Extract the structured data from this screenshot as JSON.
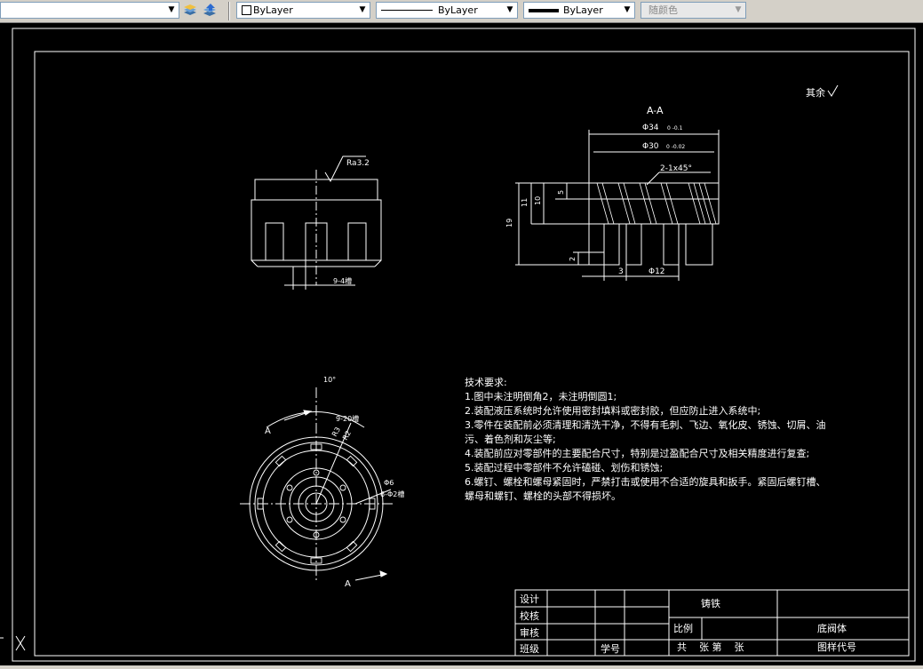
{
  "toolbar": {
    "layer_combo": {
      "value": ""
    },
    "color_combo": {
      "value": "ByLayer"
    },
    "linetype_combo": {
      "value": "ByLayer"
    },
    "lineweight_combo": {
      "value": "ByLayer"
    },
    "plotstyle_combo": {
      "value": "随颜色"
    }
  },
  "drawing": {
    "section_label": "A-A",
    "dim_phi34": "Φ34",
    "dim_phi34_tol": "0 -0.1",
    "dim_phi30": "Φ30",
    "dim_phi30_tol": "0 -0.02",
    "chamfer": "2-1x45°",
    "dim_19": "19",
    "dim_11": "11",
    "dim_10": "10",
    "dim_5": "5",
    "dim_2": "2",
    "dim_3": "3",
    "dim_phi12": "Φ12",
    "roughness": "Ra3.2",
    "dim_slot": "9-4槽",
    "other_roughness": "其余",
    "angle_10": "10°",
    "dim_9_20": "9-20槽",
    "dim_6_phi2": "6-Φ2槽",
    "dim_phi6": "Φ6",
    "dim_r3": "R3",
    "dim_r2": "R2",
    "cut_a_top": "A",
    "cut_a_bottom": "A"
  },
  "tech": {
    "title": "技术要求:",
    "lines": [
      "1.图中未注明倒角2，未注明倒圆1;",
      "2.装配液压系统时允许使用密封填料或密封胶，但应防止进入系统中;",
      "3.零件在装配前必须清理和清洗干净，不得有毛刺、飞边、氧化皮、锈蚀、切屑、油",
      "污、着色剂和灰尘等;",
      "4.装配前应对零部件的主要配合尺寸，特别是过盈配合尺寸及相关精度进行复查;",
      "5.装配过程中零部件不允许磕碰、划伤和锈蚀;",
      "6.螺钉、螺栓和螺母紧固时，严禁打击或使用不合适的旋具和扳手。紧固后螺钉槽、",
      "螺母和螺钉、螺栓的头部不得损坏。"
    ]
  },
  "title_block": {
    "design": "设计",
    "check": "校核",
    "review": "审核",
    "class": "班级",
    "student_no": "学号",
    "material": "铸铁",
    "scale": "比例",
    "part_name": "底阀体",
    "sheets": "共    张 第    张",
    "drawing_no": "图样代号"
  },
  "colors": {
    "background": "#000000",
    "lines": "#ffffff"
  }
}
